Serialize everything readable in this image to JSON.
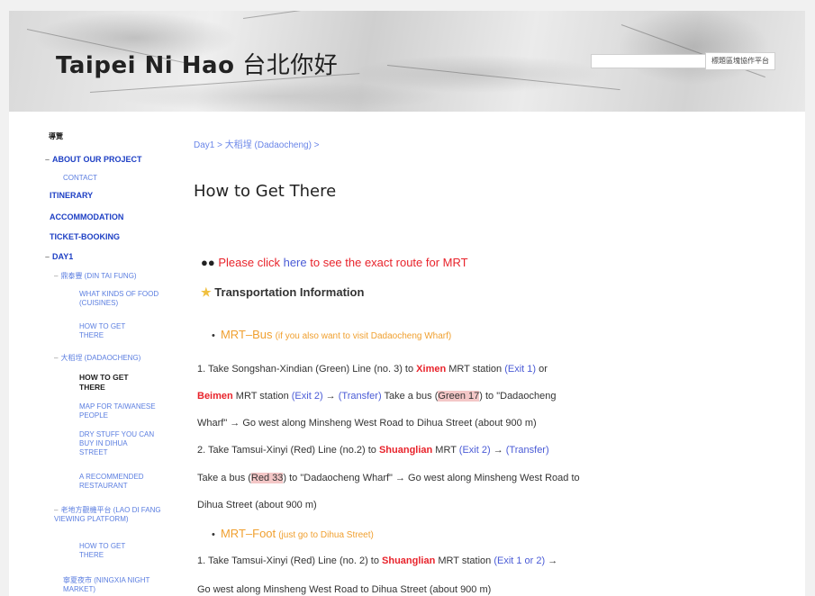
{
  "header": {
    "title_bold": "Taipei Ni Hao",
    "title_rest": " 台北你好",
    "search_placeholder": "",
    "mgmt_button": "標題區塊協作平台"
  },
  "sidebar": {
    "items": [
      {
        "label": "導覽"
      },
      {
        "label": "ABOUT OUR PROJECT"
      },
      {
        "label": "CONTACT"
      },
      {
        "label": "ITINERARY"
      },
      {
        "label": "ACCOMMODATION"
      },
      {
        "label": "TICKET-BOOKING"
      },
      {
        "label": "DAY1"
      },
      {
        "label": "鼎泰豐 (DIN TAI FUNG)"
      },
      {
        "label": "WHAT KINDS OF FOOD (CUISINES)"
      },
      {
        "label": "HOW TO GET THERE"
      },
      {
        "label": "大稻埕 (DADAOCHENG)"
      },
      {
        "label": "HOW TO GET THERE"
      },
      {
        "label": "MAP FOR TAIWANESE PEOPLE"
      },
      {
        "label": "DRY STUFF YOU CAN BUY IN DIHUA STREET"
      },
      {
        "label": "A RECOMMENDED RESTAURANT"
      },
      {
        "label": "老地方觀機平台 (LAO DI FANG VIEWING PLATFORM)"
      },
      {
        "label": "HOW TO GET THERE"
      },
      {
        "label": "寧夏夜市 (NINGXIA NIGHT MARKET)"
      }
    ]
  },
  "main": {
    "breadcrumb": "Day1 > 大稻埕 (Dadaocheng) >",
    "title": "How to Get There",
    "click_pre": "Please click ",
    "click_link": "here",
    "click_post": " to see the exact route for MRT",
    "transport_heading": "Transportation Information",
    "mrt_bus": "MRT–Bus",
    "mrt_bus_note": "(if you also want to visit Dadaocheng Wharf)",
    "l1a": "1. Take Songshan-Xindian (Green) Line (no. 3) to ",
    "ximen": "Ximen",
    "l1b": " MRT station ",
    "exit1": "(Exit 1)",
    "l1c": " or",
    "beimen": "Beimen",
    "l2a": " MRT station ",
    "exit2": "(Exit 2)",
    "arrow": " → ",
    "transfer": "(Transfer)",
    "l2b": " Take a bus (",
    "green17": "Green 17",
    "l2c": ") to \"Dadaocheng",
    "l3": "Wharf\" → Go west along Minsheng West Road to Dihua Street (about 900 m)",
    "l4a": "2. Take Tamsui-Xinyi (Red) Line (no.2) to ",
    "shuanglian": "Shuanglian",
    "l4b": " MRT ",
    "exit2b": "(Exit 2)",
    "l5a": "Take a bus (",
    "red33": "Red 33",
    "l5b": ") to \"Dadaocheng Wharf\" → Go west along Minsheng West Road to",
    "l6": "Dihua Street (about 900 m)",
    "mrt_foot": "MRT–Foot",
    "mrt_foot_note": "(just go to Dihua Street)",
    "l7a": "1. Take Tamsui-Xinyi (Red) Line (no. 2)  to ",
    "l7b": " MRT station ",
    "exit12": "(Exit 1 or 2)",
    "l7c": " →",
    "l8": "Go west along Minsheng West Road to Dihua Street (about 900 m)"
  }
}
